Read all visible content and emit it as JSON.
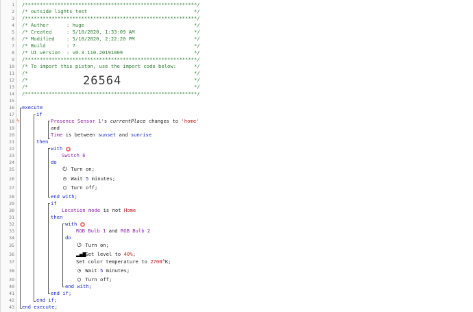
{
  "line_numbers": [
    "1",
    "2",
    "3",
    "4",
    "5",
    "6",
    "7",
    "8",
    "9",
    "10",
    "11",
    "12",
    "13",
    "14",
    "15",
    "16",
    "17",
    "18",
    "19",
    "20",
    "21",
    "22",
    "23",
    "24",
    "25",
    "26",
    "27",
    "28",
    "29",
    "30",
    "31",
    "32",
    "33",
    "34",
    "35",
    "36",
    "37",
    "38",
    "39",
    "40",
    "41",
    "42",
    "43"
  ],
  "header": {
    "border": "/**********************************************************/",
    "title_line": "/* outside lights test                                    */",
    "author_line": "/* Author      : huge                                     */",
    "created_line": "/* Created     : 5/10/2020, 1:33:09 AM                    */",
    "modified_line": "/* Modified    : 5/10/2020, 2:22:20 PM                    */",
    "build_line": "/* Build       : 7                                        */",
    "ui_line": "/* UI version  : v0.3.110.20191009                        */",
    "import_line": "/* To import this piston, use the import code below:      */",
    "blank_line": "/*                                                        */",
    "import_code": "26564"
  },
  "code": {
    "execute": "execute",
    "if": "if",
    "presence_device": "Presence Sensor 1",
    "apos_s": "'s",
    "attr_current_place": "currentPlace",
    "changes_to": "changes to",
    "home_str": "'home'",
    "and": "and",
    "time": "Time",
    "is_between": "is between",
    "sunset": "sunset",
    "sunrise": "sunrise",
    "then": "then",
    "with": "with",
    "switch6": "Switch 6",
    "do": "do",
    "turn_on": "Turn on;",
    "wait_prefix": "Wait",
    "wait_val": "5",
    "wait_suffix": "minutes;",
    "turn_off": "Turn off;",
    "end_with": "end with;",
    "location": "Location mode",
    "is_not": "is not",
    "home": "Home",
    "rgb1": "RGB Bulb 1",
    "rgb2": "RGB Bulb 2",
    "set_level_prefix": "Set level to",
    "set_level_val": "40%",
    "set_color_prefix": "Set color temperature to",
    "set_color_val": "2700",
    "set_color_suffix": "°K;",
    "semi": ";",
    "end_if": "end if;",
    "end_execute": "end execute;"
  },
  "icons": {
    "trigger": "lightning-icon",
    "settings": "gear-icon",
    "power": "power-icon",
    "clock": "clock-icon",
    "level": "signal-bars-icon"
  },
  "colors": {
    "comment": "#2e7d32",
    "keyword": "#1a28c9",
    "device": "#8e24aa",
    "string": "#b71c1c"
  }
}
